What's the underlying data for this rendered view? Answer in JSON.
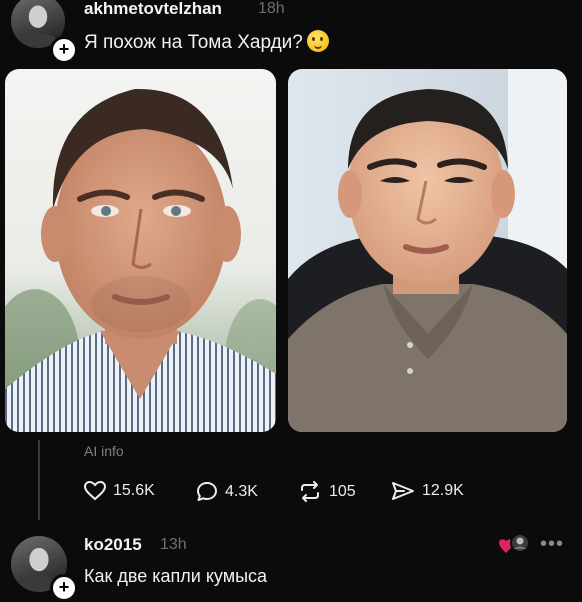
{
  "post": {
    "username": "akhmetovtelzhan",
    "time": "18h",
    "text": "Я похож на Тома Харди?",
    "emoji_icon": "thinking-face-icon",
    "ai_label": "AI info",
    "actions": {
      "likes": "15.6K",
      "comments": "4.3K",
      "reposts": "105",
      "shares": "12.9K"
    }
  },
  "reply": {
    "username": "ko2015",
    "time": "13h",
    "text": "Как две капли кумыса",
    "more_icon": "more-dots-icon",
    "more_label": "•••"
  },
  "colors": {
    "background": "#0b0b0b",
    "text": "#f3f3f3",
    "muted": "#6e6e6e",
    "heart_reaction": "#e0245e"
  }
}
